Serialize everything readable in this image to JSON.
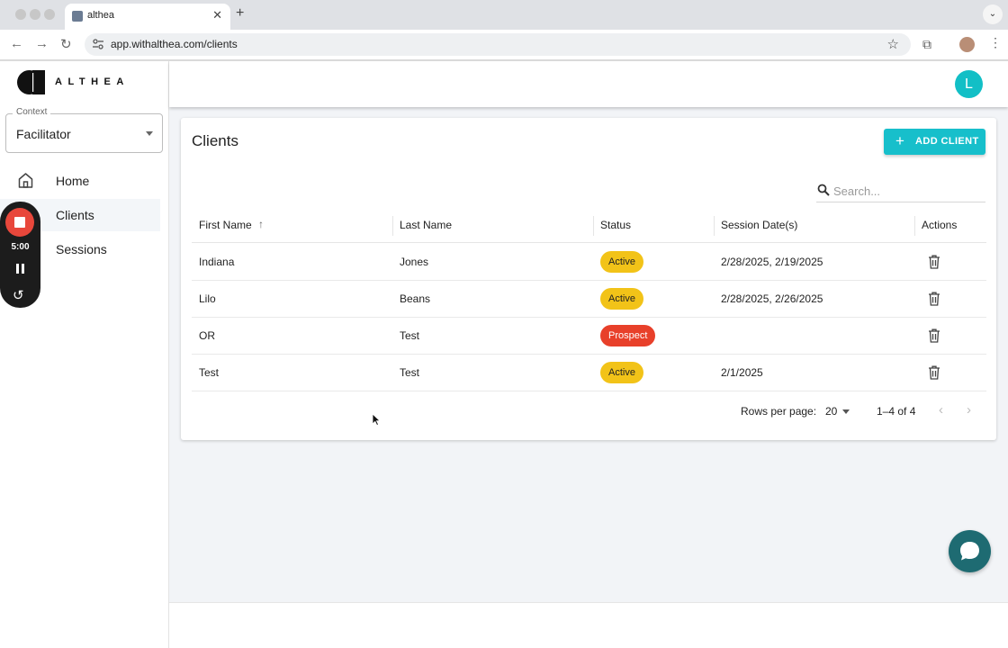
{
  "browser": {
    "tab_title": "althea",
    "tab_close": "✕",
    "new_tab": "+",
    "url": "app.withalthea.com/clients",
    "icons": [
      "back-icon",
      "forward-icon",
      "reload-icon",
      "site-info-icon",
      "star-icon",
      "extensions-icon",
      "kebab-menu-icon"
    ]
  },
  "app": {
    "logo_text": "ALTHEA",
    "context": {
      "label": "Context",
      "value": "Facilitator"
    },
    "nav": [
      {
        "label": "Home",
        "icon": "home-icon"
      },
      {
        "label": "Clients",
        "active": true
      },
      {
        "label": "Sessions"
      }
    ],
    "recorder": {
      "time": "5:00",
      "icons": [
        "stop-icon",
        "pause-icon",
        "restart-icon"
      ]
    },
    "user_initial": "L",
    "accent_color": "#17bfcb"
  },
  "clients": {
    "title": "Clients",
    "add_button": "ADD CLIENT",
    "search_placeholder": "Search...",
    "columns": [
      "First Name",
      "Last Name",
      "Status",
      "Session Date(s)",
      "Actions"
    ],
    "sort": {
      "column": "First Name",
      "direction": "ascending"
    },
    "rows": [
      {
        "first": "Indiana",
        "last": "Jones",
        "status": "Active",
        "dates": "2/28/2025, 2/19/2025"
      },
      {
        "first": "Lilo",
        "last": "Beans",
        "status": "Active",
        "dates": "2/28/2025, 2/26/2025"
      },
      {
        "first": "OR",
        "last": "Test",
        "status": "Prospect",
        "dates": ""
      },
      {
        "first": "Test",
        "last": "Test",
        "status": "Active",
        "dates": "2/1/2025"
      }
    ],
    "status_colors": {
      "Active": "#f2c318",
      "Prospect": "#e8402a"
    },
    "pagination": {
      "rows_label": "Rows per page:",
      "rows_per_page": "20",
      "range": "1–4 of 4"
    }
  }
}
